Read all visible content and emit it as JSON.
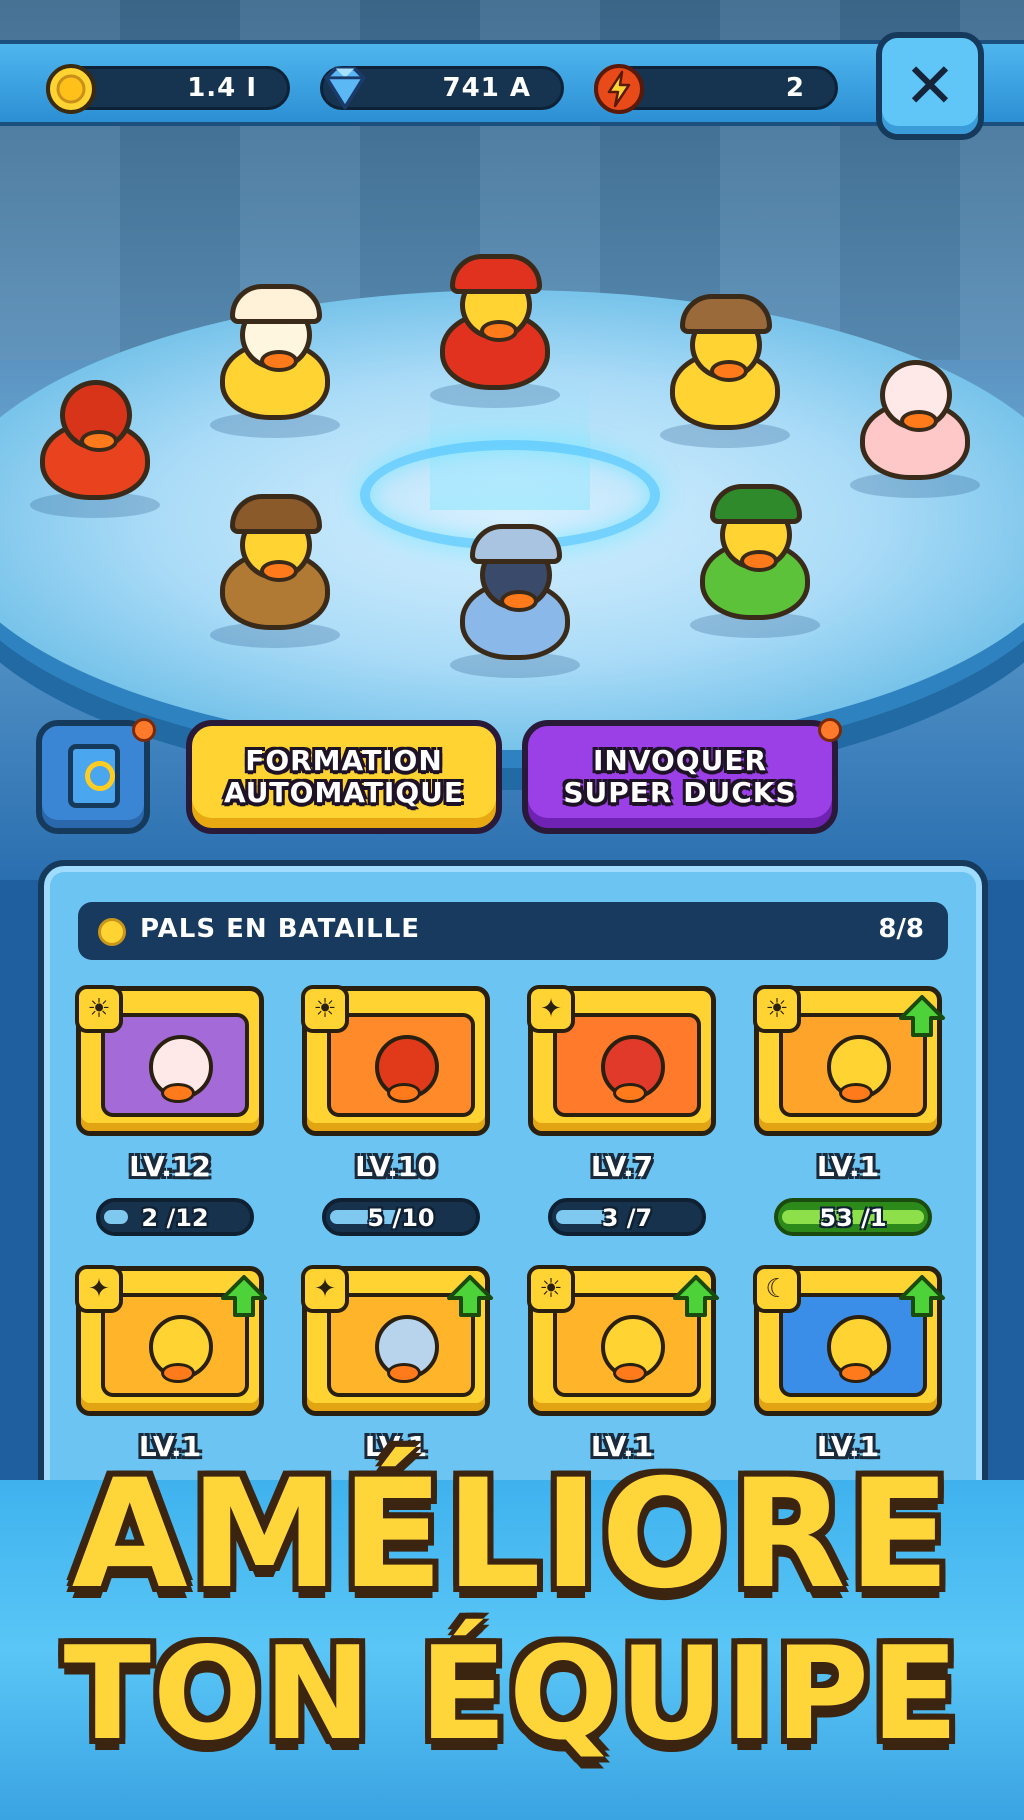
{
  "resources": {
    "coins": {
      "icon": "coin-icon",
      "value": "1.4 I"
    },
    "gems": {
      "icon": "diamond-icon",
      "value": "741 A"
    },
    "energy": {
      "icon": "lightning-icon",
      "value": "2"
    }
  },
  "close_label": "✕",
  "actions": {
    "book_icon": "book-icon",
    "auto_formation": "FORMATION\nAUTOMATIQUE",
    "summon": "INVOQUER\nSUPER DUCKS"
  },
  "panel": {
    "title": "PALS EN BATAILLE",
    "count": "8/8",
    "cards": [
      {
        "element": "☀",
        "level": "LV.12",
        "progress": "2 /12",
        "fill": 0.17,
        "upgrade": false,
        "bg": "#a46ad8",
        "duck": "#ffe8e8"
      },
      {
        "element": "☀",
        "level": "LV.10",
        "progress": "5 /10",
        "fill": 0.5,
        "upgrade": false,
        "bg": "#ff8a2a",
        "duck": "#e03a1a"
      },
      {
        "element": "✦",
        "level": "LV.7",
        "progress": "3 /7",
        "fill": 0.43,
        "upgrade": false,
        "bg": "#ff7a2a",
        "duck": "#e23a2a"
      },
      {
        "element": "☀",
        "level": "LV.1",
        "progress": "53 /1",
        "fill": 1,
        "upgrade": true,
        "bg": "#ffa42a",
        "duck": "#ffd332"
      },
      {
        "element": "✦",
        "level": "LV.1",
        "progress": "",
        "fill": 0,
        "upgrade": true,
        "bg": "#ffb42a",
        "duck": "#ffd332"
      },
      {
        "element": "✦",
        "level": "LV.1",
        "progress": "",
        "fill": 0,
        "upgrade": true,
        "bg": "#ffb42a",
        "duck": "#b8d4ec"
      },
      {
        "element": "☀",
        "level": "LV.1",
        "progress": "",
        "fill": 0,
        "upgrade": true,
        "bg": "#ffb42a",
        "duck": "#ffd332"
      },
      {
        "element": "☾",
        "level": "LV.1",
        "progress": "",
        "fill": 0,
        "upgrade": true,
        "bg": "#3a8ee8",
        "duck": "#ffd332"
      }
    ]
  },
  "promo": {
    "line1": "AMÉLIORE",
    "line2": "TON ÉQUIPE"
  },
  "colors": {
    "accent_yellow": "#ffd332",
    "accent_purple": "#9b40e6",
    "panel_blue": "#6cc4f2",
    "dark_outline": "#163a5c"
  }
}
